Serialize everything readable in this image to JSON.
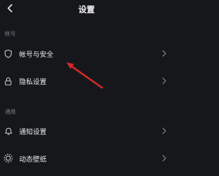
{
  "header": {
    "title": "设置",
    "back_icon": "chevron-left-icon"
  },
  "sections": [
    {
      "label": "帐号",
      "items": [
        {
          "label": "帐号与安全",
          "icon": "shield-icon"
        },
        {
          "label": "隐私设置",
          "icon": "lock-icon"
        }
      ]
    },
    {
      "label": "通用",
      "items": [
        {
          "label": "通知设置",
          "icon": "bell-icon"
        },
        {
          "label": "动态壁纸",
          "icon": "wallpaper-icon"
        }
      ]
    }
  ],
  "annotation": {
    "icon": "red-arrow-icon",
    "color": "#d42a2a"
  },
  "colors": {
    "background": "#16171b",
    "section_label": "#7c7e86",
    "text": "#e8e8e8"
  }
}
